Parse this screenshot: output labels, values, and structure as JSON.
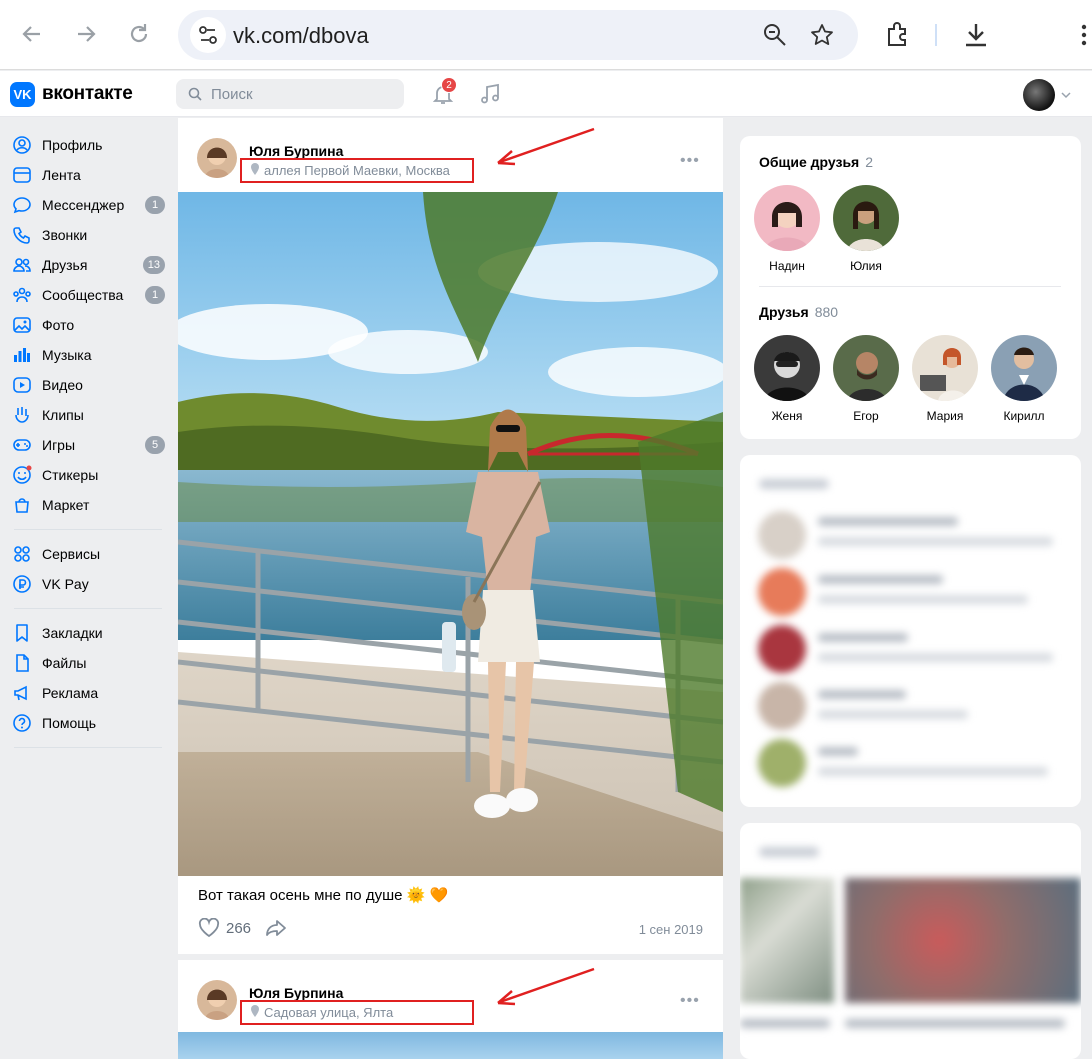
{
  "browser": {
    "url": "vk.com/dbova"
  },
  "header": {
    "logo_text": "вконтакте",
    "search_placeholder": "Поиск",
    "notifications_count": "2"
  },
  "menu": {
    "items": [
      {
        "label": "Профиль",
        "icon": "profile-icon"
      },
      {
        "label": "Лента",
        "icon": "feed-icon"
      },
      {
        "label": "Мессенджер",
        "icon": "messenger-icon",
        "count": "1"
      },
      {
        "label": "Звонки",
        "icon": "phone-icon"
      },
      {
        "label": "Друзья",
        "icon": "friends-icon",
        "count": "13"
      },
      {
        "label": "Сообщества",
        "icon": "communities-icon",
        "count": "1"
      },
      {
        "label": "Фото",
        "icon": "photo-icon"
      },
      {
        "label": "Музыка",
        "icon": "music-icon"
      },
      {
        "label": "Видео",
        "icon": "video-icon"
      },
      {
        "label": "Клипы",
        "icon": "clips-icon"
      },
      {
        "label": "Игры",
        "icon": "games-icon",
        "count": "5"
      },
      {
        "label": "Стикеры",
        "icon": "stickers-icon"
      },
      {
        "label": "Маркет",
        "icon": "market-icon"
      }
    ],
    "services": [
      {
        "label": "Сервисы",
        "icon": "services-icon"
      },
      {
        "label": "VK Pay",
        "icon": "vkpay-icon"
      }
    ],
    "extra": [
      {
        "label": "Закладки",
        "icon": "bookmark-icon"
      },
      {
        "label": "Файлы",
        "icon": "files-icon"
      },
      {
        "label": "Реклама",
        "icon": "ads-icon"
      },
      {
        "label": "Помощь",
        "icon": "help-icon"
      }
    ]
  },
  "posts": [
    {
      "author": "Юля Бурпина",
      "location": "аллея Первой Маевки, Москва",
      "text": "Вот такая осень мне по душе 🌞 🧡",
      "likes": "266",
      "date": "1 сен 2019"
    },
    {
      "author": "Юля Бурпина",
      "location": "Садовая улица, Ялта"
    }
  ],
  "sidebar": {
    "mutual": {
      "title": "Общие друзья",
      "count": "2",
      "people": [
        "Надин",
        "Юлия"
      ]
    },
    "friends": {
      "title": "Друзья",
      "count": "880",
      "people": [
        "Женя",
        "Егор",
        "Мария",
        "Кирилл"
      ]
    }
  },
  "colors": {
    "accent": "#0077ff",
    "annotation": "#e02020",
    "badge": "#e64646"
  }
}
